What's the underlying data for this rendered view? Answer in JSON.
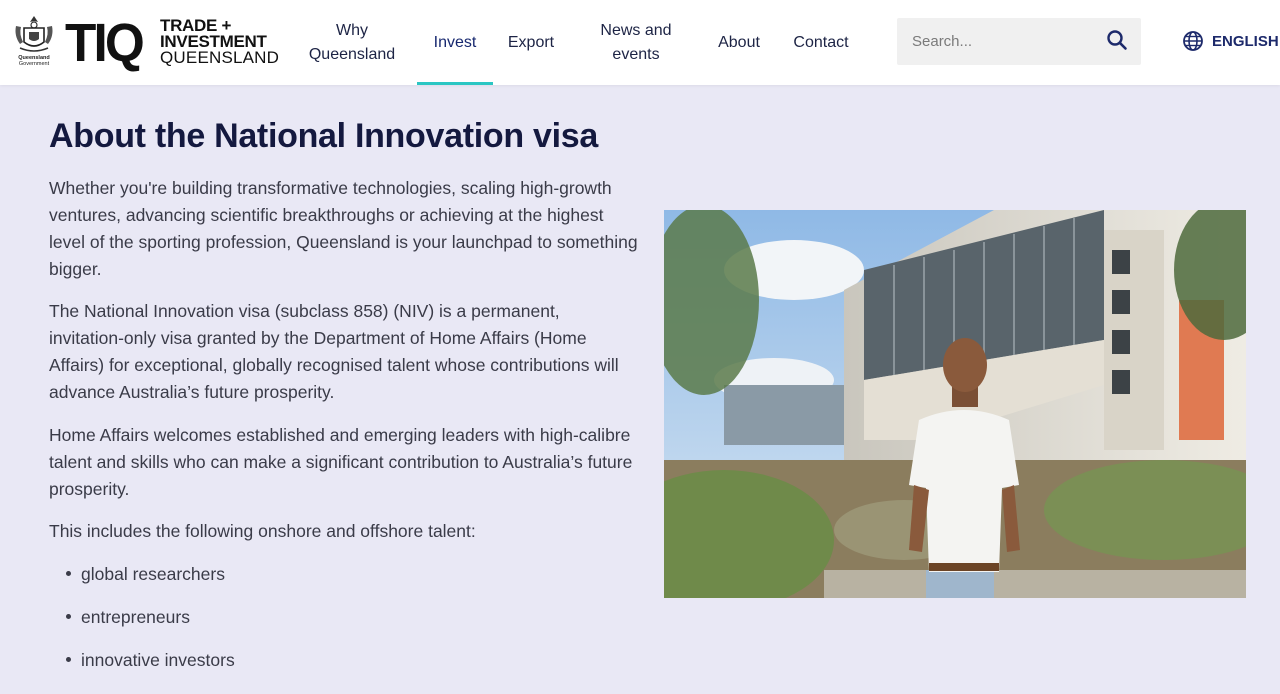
{
  "header": {
    "qg_label_line1": "Queensland",
    "qg_label_line2": "Government",
    "logo_mark": "TIQ",
    "logo_line1": "TRADE +",
    "logo_line2": "INVESTMENT",
    "logo_line3": "QUEENSLAND",
    "nav": {
      "why_line1": "Why",
      "why_line2": "Queensland",
      "invest": "Invest",
      "export": "Export",
      "news_line1": "News and",
      "news_line2": "events",
      "about": "About",
      "contact": "Contact"
    },
    "active_nav": "Invest",
    "search_placeholder": "Search...",
    "language": "ENGLISH"
  },
  "main": {
    "title": "About the National Innovation visa",
    "paragraphs": [
      "Whether you're building transformative technologies, scaling high-growth ventures, advancing scientific breakthroughs or achieving at the highest level of the sporting profession, Queensland is your launchpad to something bigger.",
      "The National Innovation visa (subclass 858) (NIV) is a permanent, invitation-only visa granted by the Department of Home Affairs (Home Affairs) for exceptional, globally recognised talent whose contributions will advance Australia’s future prosperity.",
      "Home Affairs welcomes established and emerging leaders with high-calibre talent and skills who can make a significant contribution to Australia’s future prosperity.",
      "This includes the following onshore and offshore talent:"
    ],
    "bullets": [
      "global researchers",
      "entrepreneurs",
      "innovative investors"
    ]
  },
  "colors": {
    "page_background": "#e9e8f5",
    "title": "#14193f",
    "nav_active_underline": "#2bc6c3",
    "language_accent": "#1d2a6b"
  },
  "icons": {
    "search": "search-icon",
    "language": "globe-icon",
    "crest": "coat-of-arms-icon"
  }
}
